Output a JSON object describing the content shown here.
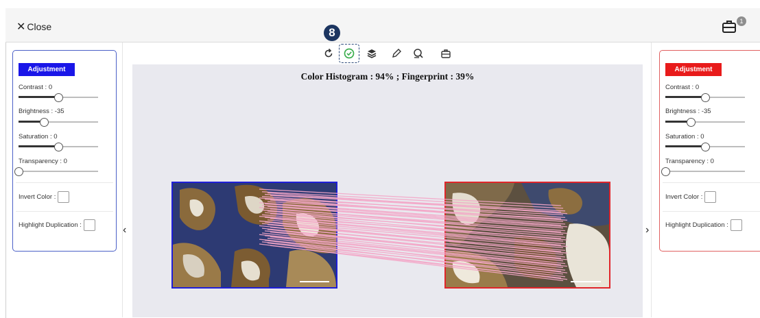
{
  "header": {
    "close_label": "Close",
    "toolbox_badge": "1"
  },
  "toolbar": {
    "step_badge": "8",
    "tools": [
      "refresh-icon",
      "check-circle-icon",
      "layers-icon",
      "pencil-icon",
      "search-chat-icon",
      "briefcase-icon"
    ],
    "active_tool": "check-circle-icon"
  },
  "result_text": "Color Histogram : 94%  ;  Fingerprint : 39%",
  "left_panel": {
    "adjustment_label": "Adjustment",
    "accent": "#1a16e8",
    "contrast_label": "Contrast : 0",
    "contrast_level": 0.5,
    "brightness_label": "Brightness : -35",
    "brightness_level": 0.32,
    "saturation_label": "Saturation : 0",
    "saturation_level": 0.5,
    "transparency_label": "Transparency : 0",
    "transparency_level": 0,
    "invert_label": "Invert Color :",
    "highlight_label": "Highlight Duplication :"
  },
  "right_panel": {
    "adjustment_label": "Adjustment",
    "accent": "#e81b1b",
    "contrast_label": "Contrast : 0",
    "contrast_level": 0.5,
    "brightness_label": "Brightness : -35",
    "brightness_level": 0.32,
    "saturation_label": "Saturation : 0",
    "saturation_level": 0.5,
    "transparency_label": "Transparency : 0",
    "transparency_level": 0,
    "invert_label": "Invert Color :",
    "highlight_label": "Highlight Duplication :"
  },
  "nav": {
    "prev_icon": "chevron-left-icon",
    "next_icon": "chevron-right-icon"
  },
  "colors": {
    "match_lines": "#f4a7c8",
    "left_border": "#1e1ed8",
    "right_border": "#e0252a"
  }
}
